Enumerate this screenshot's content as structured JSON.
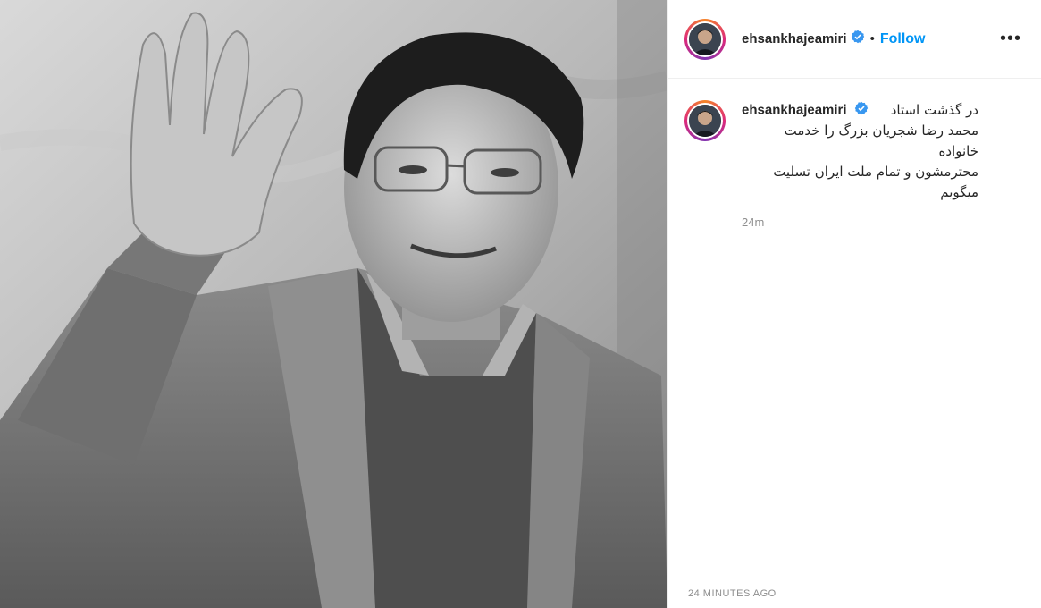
{
  "post": {
    "username": "ehsankhajeamiri",
    "follow_label": "Follow",
    "separator": "•",
    "more_label": "•••",
    "caption_lines": [
      "در گذشت استاد",
      "محمد رضا شجریان بزرگ را خدمت خانواده",
      "محترمشون و تمام ملت ایران تسلیت",
      "میگویم"
    ],
    "relative_time": "24m",
    "timestamp": "24 MINUTES AGO"
  },
  "colors": {
    "accent": "#0095f6",
    "muted": "#8e8e8e",
    "verified": "#3897f0"
  }
}
